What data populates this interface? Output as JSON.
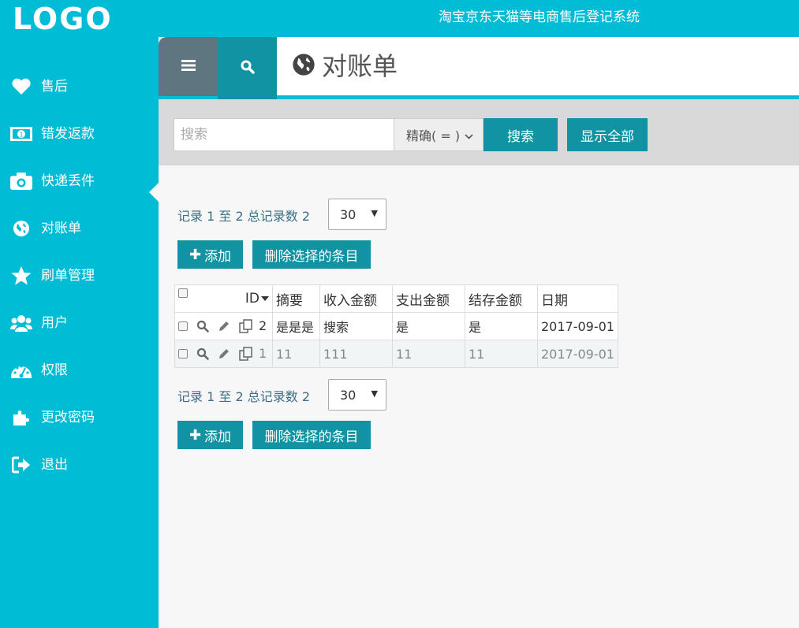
{
  "app": {
    "logo": "LOGO",
    "title": "淘宝京东天猫等电商售后登记系统"
  },
  "sidebar": {
    "items": [
      {
        "label": "售后",
        "icon": "heart-icon"
      },
      {
        "label": "错发返款",
        "icon": "money-icon"
      },
      {
        "label": "快递丢件",
        "icon": "camera-icon"
      },
      {
        "label": "对账单",
        "icon": "globe-icon",
        "active": true
      },
      {
        "label": "刷单管理",
        "icon": "star-icon"
      },
      {
        "label": "用户",
        "icon": "users-icon"
      },
      {
        "label": "权限",
        "icon": "dashboard-icon"
      },
      {
        "label": "更改密码",
        "icon": "puzzle-icon"
      },
      {
        "label": "退出",
        "icon": "sign-out-icon"
      }
    ]
  },
  "header": {
    "page_title": "对账单"
  },
  "search": {
    "placeholder": "搜索",
    "value": "",
    "mode": "精确( = )",
    "search_label": "搜索",
    "show_all_label": "显示全部"
  },
  "pager_top": {
    "text_prefix": "记录",
    "from": "1",
    "to_word": "至",
    "to": "2",
    "total_word": "总记录数",
    "total": "2",
    "per_page": "30"
  },
  "pager_bottom": {
    "text_prefix": "记录",
    "from": "1",
    "to_word": "至",
    "to": "2",
    "total_word": "总记录数",
    "total": "2",
    "per_page": "30"
  },
  "actions": {
    "add_label": "添加",
    "delete_label": "删除选择的条目"
  },
  "table": {
    "columns": [
      "ID",
      "摘要",
      "收入金额",
      "支出金额",
      "结存金额",
      "日期"
    ],
    "rows": [
      {
        "id": "2",
        "summary": "是是是",
        "income": "搜索",
        "expense": "是",
        "balance": "是",
        "date": "2017-09-01"
      },
      {
        "id": "1",
        "summary": "11",
        "income": "111",
        "expense": "11",
        "balance": "11",
        "date": "2017-09-01"
      }
    ]
  },
  "colors": {
    "accent": "#00bcd4",
    "button": "#1193a3",
    "menu_tab": "#5f7680"
  }
}
